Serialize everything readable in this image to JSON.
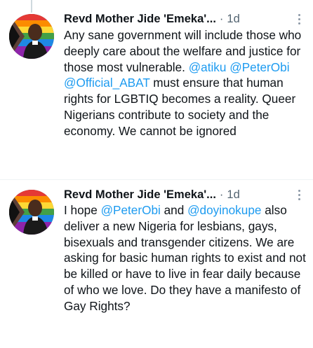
{
  "tweets": [
    {
      "author_name": "Revd Mother Jide 'Emeka'...",
      "separator": "·",
      "time": "1d",
      "segments": [
        {
          "text": "Any sane government will include those who deeply care about the welfare and justice for those most vulnerable. ",
          "mention": false
        },
        {
          "text": "@atiku",
          "mention": true
        },
        {
          "text": " ",
          "mention": false
        },
        {
          "text": "@PeterObi",
          "mention": true
        },
        {
          "text": " ",
          "mention": false
        },
        {
          "text": "@Official_ABAT",
          "mention": true
        },
        {
          "text": " must ensure that human rights for LGBTIQ becomes a reality. Queer Nigerians contribute to society and the economy. We cannot be ignored",
          "mention": false
        }
      ]
    },
    {
      "author_name": "Revd Mother Jide 'Emeka'...",
      "separator": "·",
      "time": "1d",
      "segments": [
        {
          "text": "I hope ",
          "mention": false
        },
        {
          "text": "@PeterObi",
          "mention": true
        },
        {
          "text": " and ",
          "mention": false
        },
        {
          "text": "@doyinokupe",
          "mention": true
        },
        {
          "text": " also deliver a new Nigeria for lesbians, gays, bisexuals and transgender citizens. We are asking for basic human rights to exist and not be killed or have to live in fear daily because of who we love. Do they have a manifesto of Gay Rights?",
          "mention": false
        }
      ]
    }
  ],
  "colors": {
    "mention": "#1d9bf0",
    "meta": "#536471",
    "text": "#0f1419"
  },
  "icons": [
    "avatar-photo",
    "more-options-icon"
  ]
}
